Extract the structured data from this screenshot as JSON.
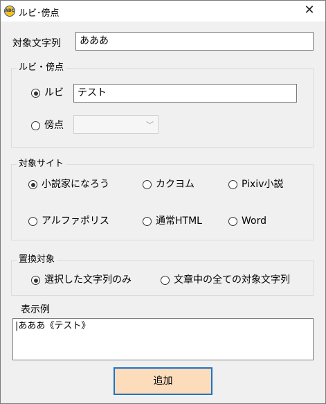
{
  "window": {
    "title": "ルビ･傍点",
    "app_icon_text": "ABC",
    "close_glyph": "✕"
  },
  "target_text": {
    "label": "対象文字列",
    "value": "あああ"
  },
  "ruby_group": {
    "caption": "ルビ・傍点",
    "ruby_option": {
      "label": "ルビ",
      "checked": true
    },
    "ruby_value": "テスト",
    "boten_option": {
      "label": "傍点",
      "checked": false
    },
    "boten_combo_value": "",
    "combo_arrow": "﹀"
  },
  "site_group": {
    "caption": "対象サイト",
    "options": [
      {
        "label": "小説家になろう",
        "checked": true
      },
      {
        "label": "カクヨム",
        "checked": false
      },
      {
        "label": "Pixiv小説",
        "checked": false
      },
      {
        "label": "アルファポリス",
        "checked": false
      },
      {
        "label": "通常HTML",
        "checked": false
      },
      {
        "label": "Word",
        "checked": false
      }
    ]
  },
  "replace_group": {
    "caption": "置換対象",
    "options": [
      {
        "label": "選択した文字列のみ",
        "checked": true
      },
      {
        "label": "文章中の全ての対象文字列",
        "checked": false
      }
    ]
  },
  "preview": {
    "label": "表示例",
    "value": "|あああ《テスト》"
  },
  "add_button": {
    "label": "追加",
    "color": "#fddcbb",
    "border_color": "#1e73c8"
  }
}
